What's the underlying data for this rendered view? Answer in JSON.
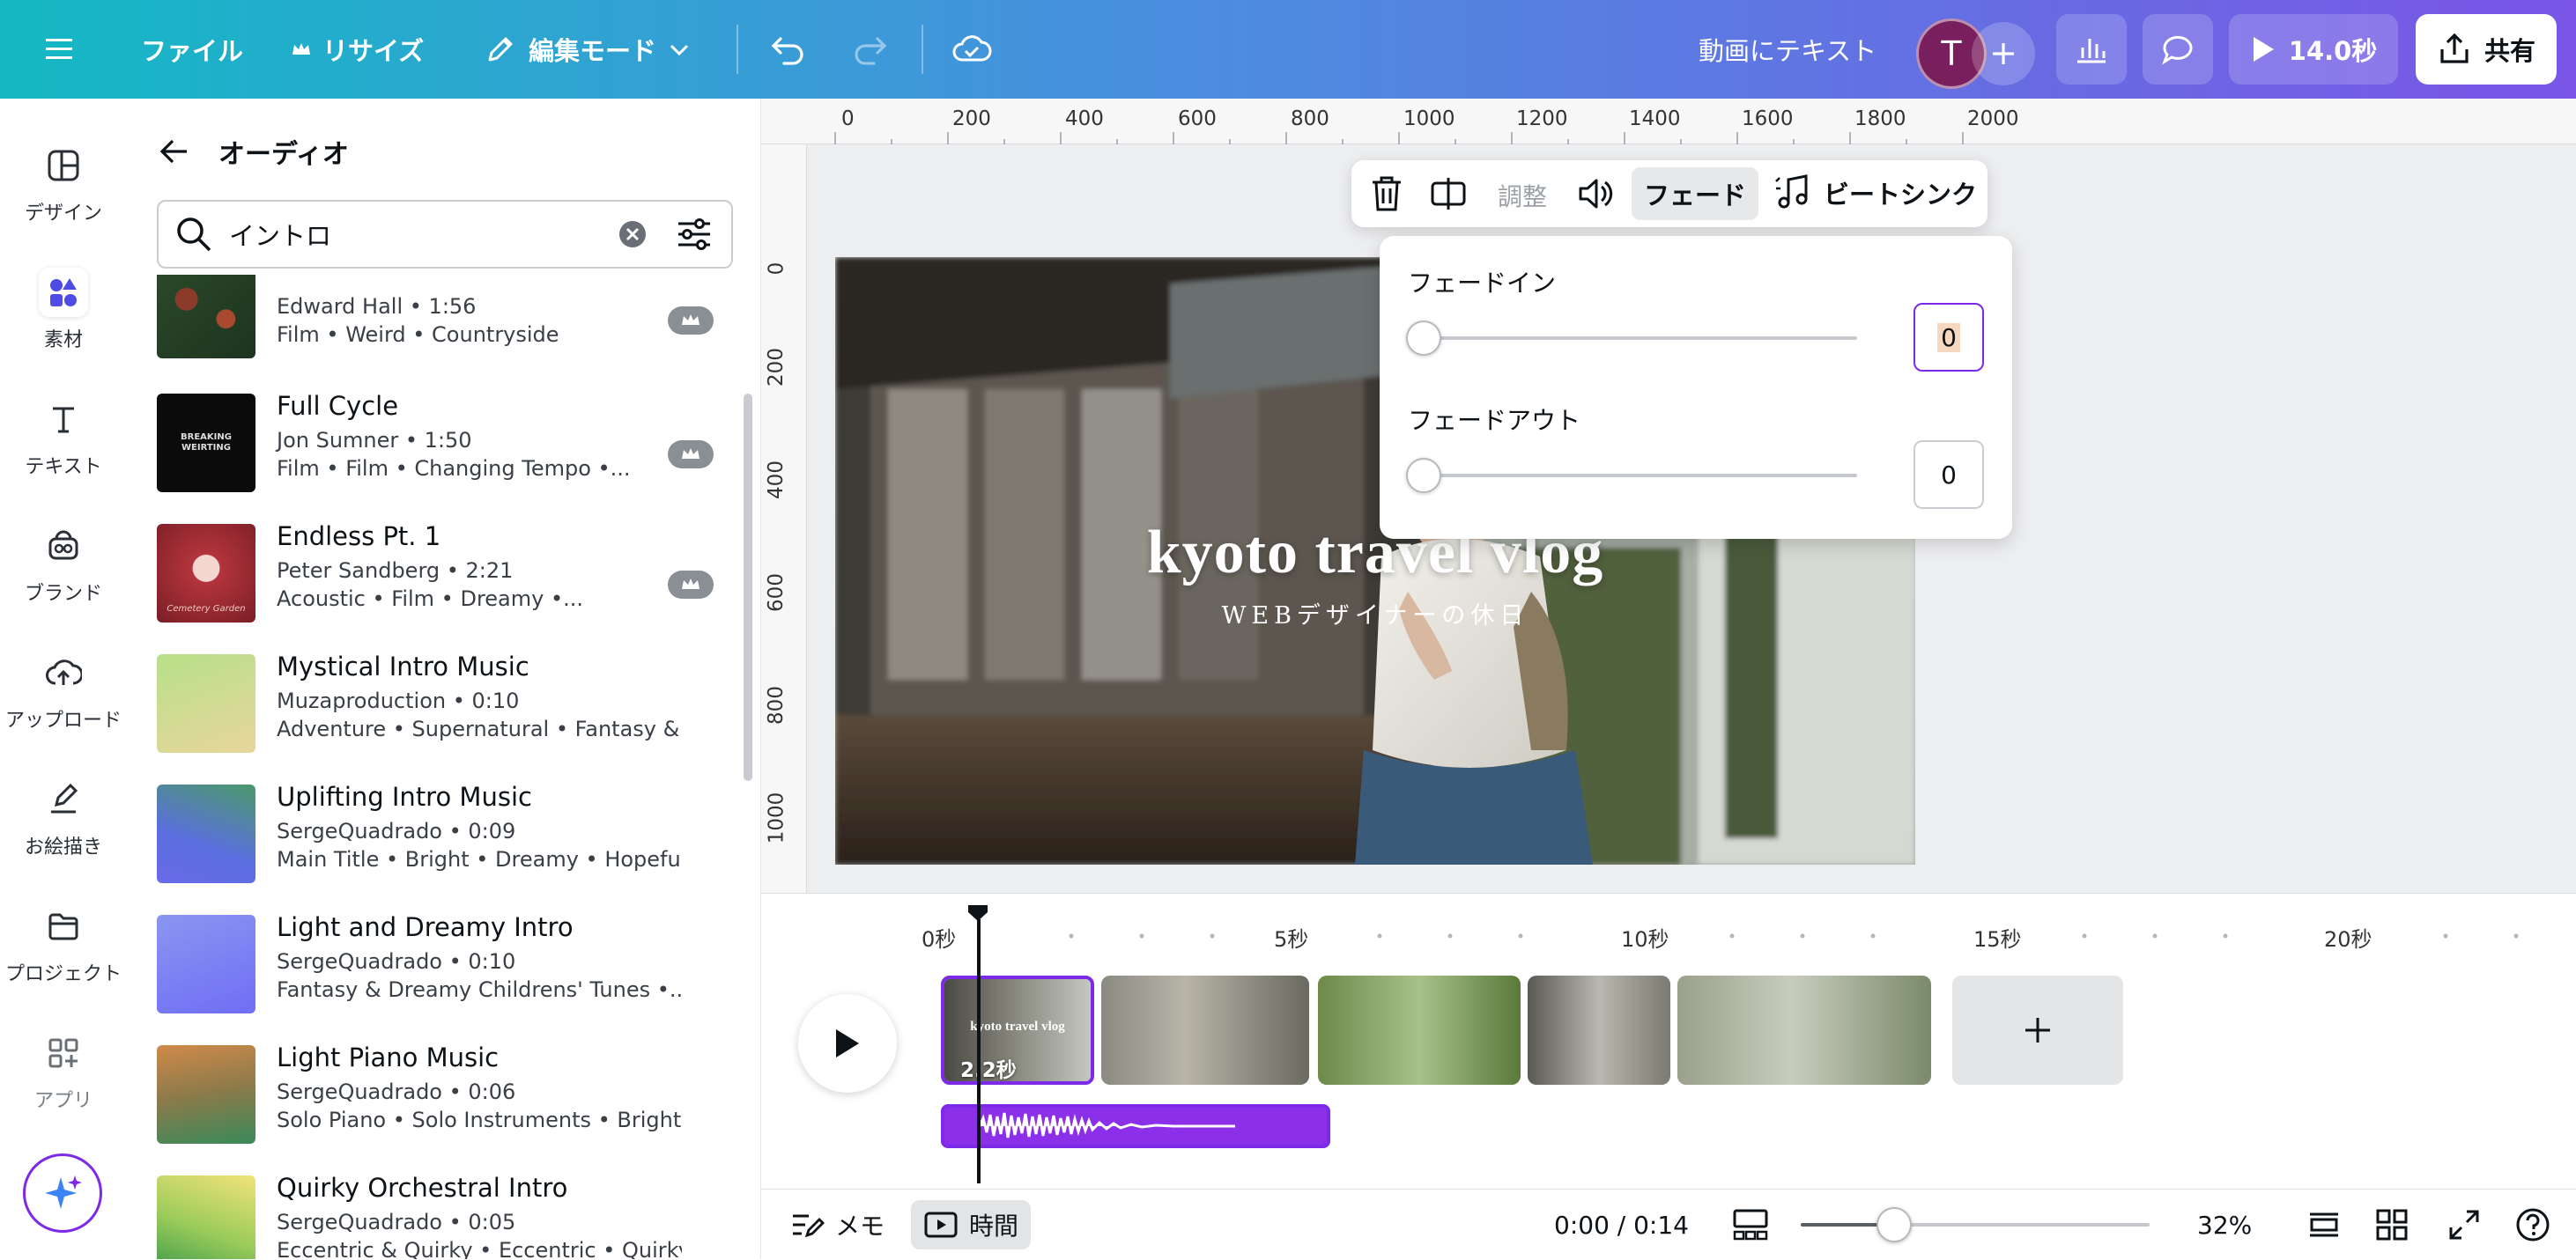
{
  "topbar": {
    "file": "ファイル",
    "resize": "リサイズ",
    "edit_mode": "編集モード",
    "text_to_video": "動画にテキスト",
    "avatar_initial": "T",
    "play_duration": "14.0秒",
    "share": "共有"
  },
  "rail": {
    "design": "デザイン",
    "elements": "素材",
    "text": "テキスト",
    "brand": "ブランド",
    "upload": "アップロード",
    "draw": "お絵描き",
    "projects": "プロジェクト",
    "apps": "アプリ"
  },
  "panel": {
    "title": "オーディオ",
    "search_value": "イントロ",
    "songs": [
      {
        "title": "",
        "artist": "Edward Hall • 1:56",
        "tags": "Film • Weird • Countryside",
        "premium": true
      },
      {
        "title": "Full Cycle",
        "artist": "Jon Sumner • 1:50",
        "tags": "Film • Film • Changing Tempo •...",
        "premium": true
      },
      {
        "title": "Endless Pt. 1",
        "artist": "Peter Sandberg • 2:21",
        "tags": "Acoustic • Film • Dreamy •...",
        "premium": true
      },
      {
        "title": "Mystical Intro Music",
        "artist": "Muzaproduction • 0:10",
        "tags": "Adventure • Supernatural • Fantasy &...",
        "premium": false
      },
      {
        "title": "Uplifting Intro Music",
        "artist": "SergeQuadrado • 0:09",
        "tags": "Main Title • Bright • Dreamy • Hopeful ...",
        "premium": false
      },
      {
        "title": "Light and Dreamy Intro",
        "artist": "SergeQuadrado • 0:10",
        "tags": "Fantasy & Dreamy Childrens' Tunes •...",
        "premium": false
      },
      {
        "title": "Light Piano Music",
        "artist": "SergeQuadrado • 0:06",
        "tags": "Solo Piano • Solo Instruments • Bright...",
        "premium": false
      },
      {
        "title": "Quirky Orchestral Intro",
        "artist": "SergeQuadrado • 0:05",
        "tags": "Eccentric & Quirky • Eccentric • Quirky",
        "premium": false
      }
    ],
    "art_colors": [
      [
        "#2c4a2a",
        "#8c3a2a"
      ],
      [
        "#0a0a0a",
        "#1c1c1c"
      ],
      [
        "#b3343c",
        "#6e1f24"
      ],
      [
        "#b7e08a",
        "#e8d69a"
      ],
      [
        "#5b6fe0",
        "#4a9a6a"
      ],
      [
        "#7d7ef5",
        "#8a96f0"
      ],
      [
        "#c98a4a",
        "#4a8a5a"
      ],
      [
        "#f2e37a",
        "#4a9a4a"
      ]
    ],
    "art_text": {
      "full_cycle": "BREAKING WEIRTING",
      "endless": "Cemetery Garden"
    }
  },
  "ruler": {
    "top": [
      "0",
      "200",
      "400",
      "600",
      "800",
      "1000",
      "1200",
      "1400",
      "1600",
      "1800",
      "2000"
    ],
    "left": [
      "0",
      "200",
      "400",
      "600",
      "800",
      "1000"
    ]
  },
  "canvas": {
    "title": "kyoto travel vlog",
    "subtitle": "WEBデザイナーの休日"
  },
  "audio_toolbar": {
    "adjust": "調整",
    "fade": "フェード",
    "beat_sync": "ビートシンク"
  },
  "fade_popup": {
    "fade_in_label": "フェードイン",
    "fade_in_value": "0",
    "fade_out_label": "フェードアウト",
    "fade_out_value": "0"
  },
  "timeline": {
    "ticks": [
      "0秒",
      "5秒",
      "10秒",
      "15秒",
      "20秒"
    ],
    "clip_duration": "2.2秒",
    "clip_title": "kyoto travel vlog"
  },
  "bottombar": {
    "memo": "メモ",
    "time": "時間",
    "timecode": "0:00 / 0:14",
    "zoom": "32%",
    "zoom_level": 0.32
  },
  "colors": {
    "accent": "#7d2ae8",
    "audio_track": "#8b2fe8"
  }
}
